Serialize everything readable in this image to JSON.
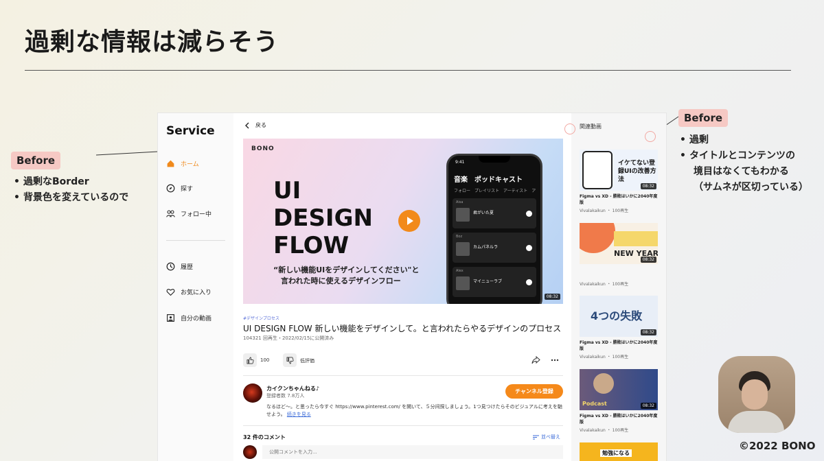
{
  "slide": {
    "title": "過剰な情報は減らそう",
    "copyright": "©2022 BONO"
  },
  "left_note": {
    "badge": "Before",
    "items": [
      "過剰なBorder",
      "背景色を変えているので"
    ]
  },
  "right_note": {
    "badge": "Before",
    "items": [
      "過剰",
      "タイトルとコンテンツの",
      "境目はなくてもわかる",
      "（サムネが区切っている）"
    ]
  },
  "mock": {
    "brand": "Service",
    "nav": [
      {
        "label": "ホーム",
        "icon": "home-icon"
      },
      {
        "label": "探す",
        "icon": "compass-icon"
      },
      {
        "label": "フォロー中",
        "icon": "people-icon"
      },
      {
        "label": "履歴",
        "icon": "clock-icon"
      },
      {
        "label": "お気に入り",
        "icon": "heart-icon"
      },
      {
        "label": "自分の動画",
        "icon": "portrait-icon"
      }
    ],
    "back_label": "戻る",
    "hero": {
      "logo": "BONO",
      "big_lines": [
        "UI",
        "DESIGN",
        "FLOW"
      ],
      "subtitle": "“新しい機能UIをデザインしてください\"と\n　言われた時に使えるデザインフロー",
      "duration": "08:32",
      "phone": {
        "time": "9:41",
        "title": "音楽　ポッドキャスト",
        "tabs": "フォロー　プレイリスト　アーティスト　ア",
        "cards": [
          {
            "who": "Aisa",
            "track": "君がいた夏"
          },
          {
            "who": "Boz",
            "track": "カムパネルラ"
          },
          {
            "who": "Alex",
            "track": "マイニューラブ"
          }
        ]
      }
    },
    "video": {
      "tag": "#デザインプロセス",
      "title": "UI DESIGN FLOW 新しい機能をデザインして。と言われたらやるデザインのプロセス",
      "meta": "104321 回再生・2022/02/15に公開済み",
      "likes": "100",
      "dislike_label": "低評価"
    },
    "channel": {
      "name": "カイクンちゃんねる♪",
      "subscribers": "登録者数 7.8万人",
      "subscribe_label": "チャンネル登録",
      "description": "なるほど〜。と思ったら今すぐ https://www.pinterest.com/ を開いて、５分间探しましょう。1つ見つけたらそのビジュアルに考えを馳せよう。",
      "more_label": "続きを見る"
    },
    "comments": {
      "count_label": "32 件のコメント",
      "sort_label": "並べ替え",
      "input_placeholder": "公開コメントを入力..."
    },
    "related": {
      "header": "関連動画",
      "items": [
        {
          "thumb_text": "イケてない登録UIの改善方法",
          "duration": "08:32",
          "title": "Figma vs XD - 勝敗はいかに2040年度版",
          "channel": "Vivalakaikun ・ 100再生"
        },
        {
          "thumb_text": "NEW YEAR",
          "duration": "08:32",
          "title": "",
          "channel": "Vivalakaikun ・ 100再生"
        },
        {
          "thumb_text": "4つの失敗",
          "duration": "08:32",
          "title": "Figma vs XD - 勝敗はいかに2040年度版",
          "channel": "Vivalakaikun ・ 100再生"
        },
        {
          "thumb_text": "Podcast",
          "duration": "08:32",
          "title": "Figma vs XD - 勝敗はいかに2040年度版",
          "channel": "Vivalakaikun ・ 100再生"
        },
        {
          "thumb_text": "勉強になる",
          "duration": "",
          "title": "",
          "channel": ""
        }
      ]
    }
  }
}
